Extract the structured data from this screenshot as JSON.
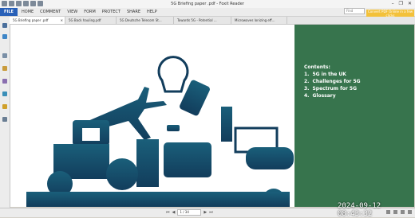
{
  "app": {
    "title": "5G Briefing paper .pdf - Foxit Reader",
    "window_controls": [
      "–",
      "❐",
      "✕"
    ]
  },
  "menu": {
    "file": "FILE",
    "items": [
      "HOME",
      "COMMENT",
      "VIEW",
      "FORM",
      "PROTECT",
      "SHARE",
      "HELP"
    ]
  },
  "search": {
    "placeholder": "Find"
  },
  "promo": {
    "text": "Convert PDF Online in a few clicks"
  },
  "tabs": [
    {
      "label": "5G Briefing paper .pdf",
      "active": true
    },
    {
      "label": "5G Back hauling.pdf",
      "active": false
    },
    {
      "label": "5G Deutsche Telecom St...",
      "active": false
    },
    {
      "label": "Towards 5G - Potential ...",
      "active": false
    },
    {
      "label": "Microwaves lonizing eff...",
      "active": false
    }
  ],
  "document": {
    "contents_heading": "Contents:",
    "contents": [
      {
        "num": "1.",
        "title": "5G in the UK"
      },
      {
        "num": "2.",
        "title": "Challenges for 5G"
      },
      {
        "num": "3.",
        "title": "Spectrum for 5G"
      },
      {
        "num": "4.",
        "title": "Glossary"
      }
    ],
    "illustration_color": "#1a5f7a",
    "panel_color": "#37744d"
  },
  "pager": {
    "first": "⏮",
    "prev": "◀",
    "page": "1 / 34",
    "next": "▶",
    "last": "⏭"
  },
  "overlay": {
    "timestamp": "2024-09-12 08:43:32"
  }
}
